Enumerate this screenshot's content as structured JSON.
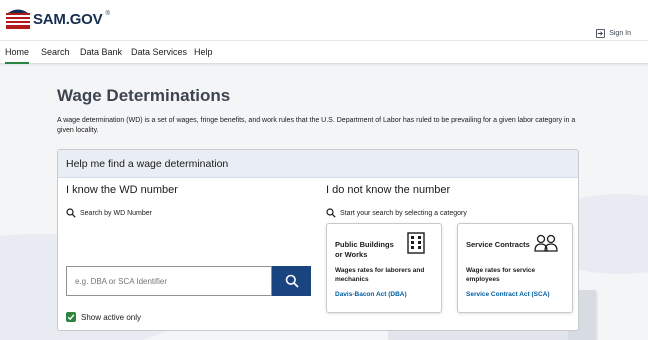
{
  "header": {
    "logo_text": "SAM.GOV",
    "logo_mark": "®",
    "sign_in": "Sign In"
  },
  "nav": {
    "items": [
      {
        "label": "Home",
        "active": true
      },
      {
        "label": "Search",
        "active": false
      },
      {
        "label": "Data Bank",
        "active": false
      },
      {
        "label": "Data Services",
        "active": false
      },
      {
        "label": "Help",
        "active": false
      }
    ]
  },
  "main": {
    "title": "Wage Determinations",
    "intro": "A wage determination (WD) is a set of wages, fringe benefits, and work rules that the U.S. Department of Labor has ruled to be prevailing for a given labor category in a given locality.",
    "card": {
      "heading": "Help me find a wage determination",
      "known": {
        "title": "I know the WD number",
        "hint": "Search by WD Number",
        "input_placeholder": "e.g. DBA or SCA Identifier",
        "input_value": "",
        "checkbox_label": "Show active only",
        "checkbox_checked": true
      },
      "unknown": {
        "title": "I do not know the number",
        "hint": "Start your search by selecting a category",
        "tiles": [
          {
            "title": "Public Buildings or Works",
            "description": "Wages rates for laborers and mechanics",
            "link": "Davis-Bacon Act (DBA)",
            "icon": "building-icon"
          },
          {
            "title": "Service Contracts",
            "description": "Wage rates for service employees",
            "link": "Service Contract Act (SCA)",
            "icon": "people-icon"
          }
        ]
      }
    }
  },
  "colors": {
    "brand_navy": "#162e51",
    "primary_button": "#1a4480",
    "active_green": "#2e8540",
    "link_blue": "#005ea2",
    "card_header": "#e9eef5"
  }
}
